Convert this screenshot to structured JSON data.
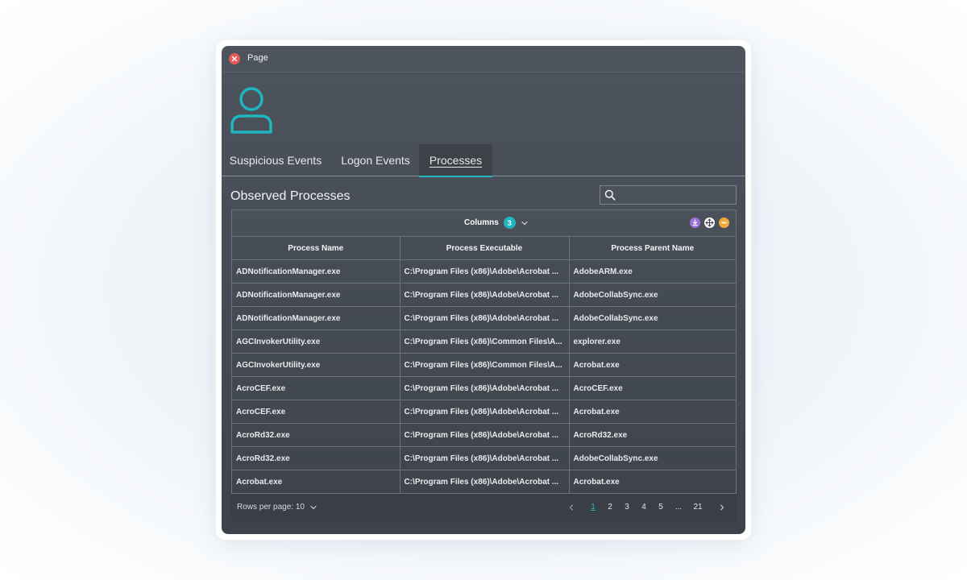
{
  "window": {
    "title": "Page"
  },
  "tabs": [
    {
      "label": "Suspicious Events",
      "active": false
    },
    {
      "label": "Logon Events",
      "active": false
    },
    {
      "label": "Processes",
      "active": true
    }
  ],
  "section": {
    "title": "Observed Processes"
  },
  "search": {
    "placeholder": "",
    "value": ""
  },
  "columns_toolbar": {
    "label": "Columns",
    "count": "3"
  },
  "table": {
    "headers": [
      "Process Name",
      "Process Executable",
      "Process Parent Name"
    ],
    "rows": [
      [
        "ADNotificationManager.exe",
        "C:\\Program Files (x86)\\Adobe\\Acrobat ...",
        "AdobeARM.exe"
      ],
      [
        "ADNotificationManager.exe",
        "C:\\Program Files (x86)\\Adobe\\Acrobat ...",
        "AdobeCollabSync.exe"
      ],
      [
        "ADNotificationManager.exe",
        "C:\\Program Files (x86)\\Adobe\\Acrobat ...",
        "AdobeCollabSync.exe"
      ],
      [
        "AGCInvokerUtility.exe",
        "C:\\Program Files (x86)\\Common Files\\A...",
        "explorer.exe"
      ],
      [
        "AGCInvokerUtility.exe",
        "C:\\Program Files (x86)\\Common Files\\A...",
        "Acrobat.exe"
      ],
      [
        "AcroCEF.exe",
        "C:\\Program Files (x86)\\Adobe\\Acrobat ...",
        "AcroCEF.exe"
      ],
      [
        "AcroCEF.exe",
        "C:\\Program Files (x86)\\Adobe\\Acrobat ...",
        "Acrobat.exe"
      ],
      [
        "AcroRd32.exe",
        "C:\\Program Files (x86)\\Adobe\\Acrobat ...",
        "AcroRd32.exe"
      ],
      [
        "AcroRd32.exe",
        "C:\\Program Files (x86)\\Adobe\\Acrobat ...",
        "AdobeCollabSync.exe"
      ],
      [
        "Acrobat.exe",
        "C:\\Program Files (x86)\\Adobe\\Acrobat ...",
        "Acrobat.exe"
      ]
    ]
  },
  "pagination": {
    "rows_per_page_label": "Rows per page: 10",
    "pages": [
      "1",
      "2",
      "3",
      "4",
      "5",
      "...",
      "21"
    ],
    "current_page": "1"
  },
  "colors": {
    "accent": "#1fb5c1",
    "close": "#e55a5a",
    "download_icon": "#9b6fdc",
    "move_icon": "#ffffff",
    "collapse_icon": "#f0a93a"
  },
  "icons": {
    "close": "close-icon",
    "user": "user-icon",
    "search": "search-icon",
    "chevron": "chevron-down-icon",
    "download": "download-icon",
    "move": "move-icon",
    "collapse": "collapse-icon",
    "prev": "chevron-left-icon",
    "next": "chevron-right-icon"
  }
}
